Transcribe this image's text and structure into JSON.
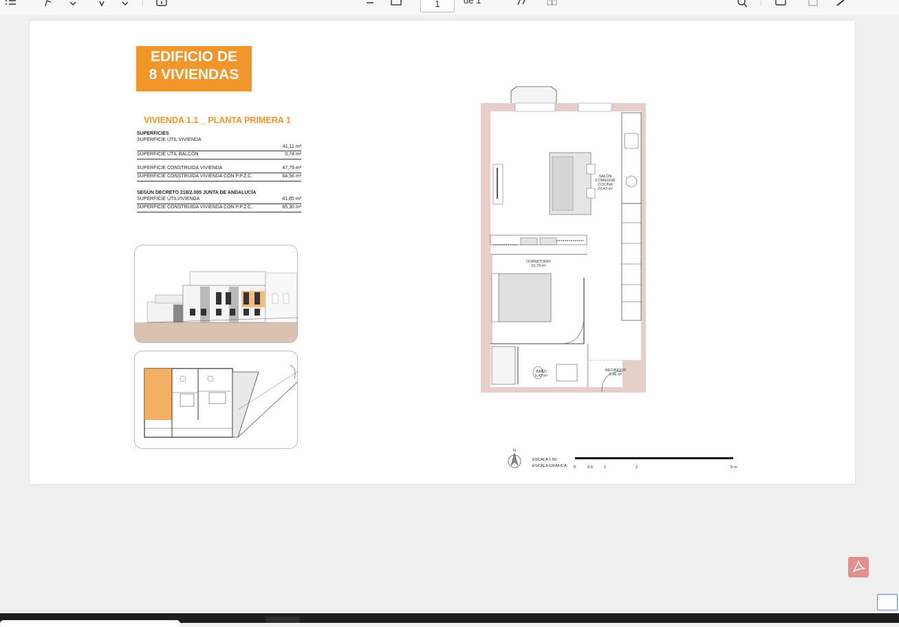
{
  "toolbar": {
    "page_current": "1",
    "page_of": "de 1",
    "icons": [
      "list-icon",
      "draw-icon",
      "chevron-down-icon",
      "highlight-icon",
      "chevron-down-icon",
      "info-icon",
      "zoom-out-icon",
      "fit-page-icon",
      "rotate-icon",
      "two-page-icon",
      "search-icon",
      "print-icon",
      "save-icon",
      "edit-icon"
    ]
  },
  "document": {
    "title_line1": "EDIFICIO DE",
    "title_line2": "8 VIVIENDAS",
    "subtitle": "VIVIENDA 1.1 _ PLANTA PRIMERA 1",
    "superficies_heading": "SUPERFICIES",
    "rows1": [
      {
        "label": "SUPERFICIE ÚTIL VIVIENDA",
        "value": "41,11 m²"
      },
      {
        "label": "SUPERFICIE ÚTIL BALCÓN",
        "value": "0,74 m²"
      }
    ],
    "rows2": [
      {
        "label": "SUPERFICIE CONSTRUIDA VIVIENDA",
        "value": "47,79 m²"
      },
      {
        "label": "SUPERFICIE CONSTRUIDA VIVIENDA CON P.P.Z.C.",
        "value": "64,56 m²"
      }
    ],
    "decree_heading": "SEGÚN DECRETO 218/2.005 JUNTA DE ANDALUCÍA",
    "rows3": [
      {
        "label": "SUPERFICIE ÚTILVIVIENDA",
        "value": "41,85 m²"
      },
      {
        "label": "SUPERFICIE CONSTRUIDA VIVIENDA CON P.P.Z.C.",
        "value": "65,30 m²"
      }
    ]
  },
  "plan": {
    "salon_1": "SALÓN",
    "salon_2": "COMEDOR",
    "salon_3": "COCINA",
    "salon_area": "22,43 m²",
    "dormitorio": "DORMITORIO",
    "dormitorio_area": "10,79 m²",
    "bano": "BAÑO",
    "bano_area": "5,43 m²",
    "recibidor": "RECIBIDOR",
    "recibidor_area": "2,46 m²"
  },
  "scale": {
    "north": "N",
    "escala": "ESCALA 1:50",
    "grafica": "ESCALA GRÁFICA",
    "t0": "0",
    "t1": "0,5",
    "t2": "1",
    "t3": "2",
    "t4": "5 m"
  },
  "colors": {
    "accent_orange": "#f0962a",
    "wall_pink": "#e6cfca",
    "acrobat": "#e2908c"
  }
}
